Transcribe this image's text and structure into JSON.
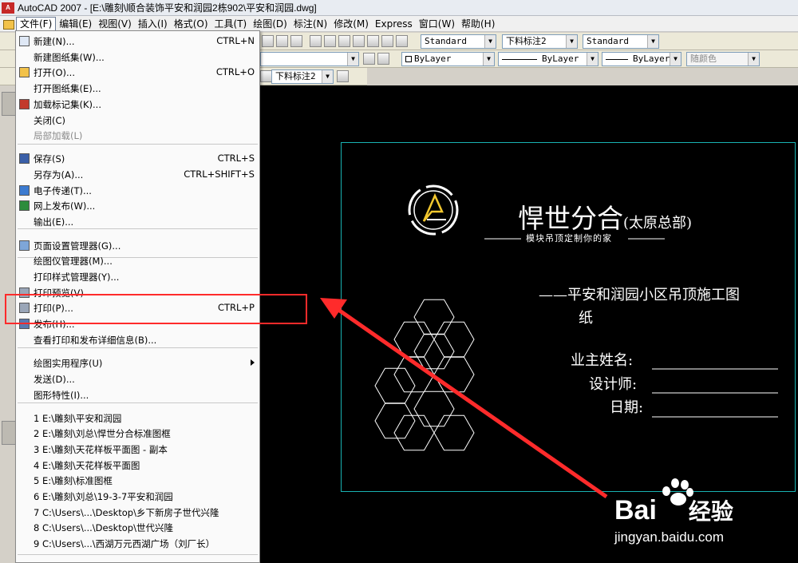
{
  "window": {
    "app_icon_text": "A",
    "title": "AutoCAD 2007 - [E:\\雕刻\\顺合装饰平安和润园2栋902\\平安和润园.dwg]"
  },
  "menubar": {
    "items": [
      {
        "label": "文件(F)",
        "active": true
      },
      {
        "label": "编辑(E)"
      },
      {
        "label": "视图(V)"
      },
      {
        "label": "插入(I)"
      },
      {
        "label": "格式(O)"
      },
      {
        "label": "工具(T)"
      },
      {
        "label": "绘图(D)"
      },
      {
        "label": "标注(N)"
      },
      {
        "label": "修改(M)"
      },
      {
        "label": "Express"
      },
      {
        "label": "窗口(W)"
      },
      {
        "label": "帮助(H)"
      }
    ]
  },
  "toolbars": {
    "text_style": "Standard",
    "dim_style": "下料标注2",
    "table_style": "Standard",
    "color": "ByLayer",
    "linetype": "ByLayer",
    "lineweight": "ByLayer",
    "plot_style": "随颜色",
    "dim_style_2": "下料标注2"
  },
  "file_menu": {
    "items": [
      {
        "label": "新建(N)...",
        "shortcut": "CTRL+N",
        "icon": "new-file-icon"
      },
      {
        "label": "新建图纸集(W)..."
      },
      {
        "label": "打开(O)...",
        "shortcut": "CTRL+O",
        "icon": "open-folder-icon"
      },
      {
        "label": "打开图纸集(E)..."
      },
      {
        "label": "加载标记集(K)...",
        "icon": "markup-icon"
      },
      {
        "label": "关闭(C)"
      },
      {
        "label": "局部加载(L)",
        "disabled": true
      },
      {
        "label": "保存(S)",
        "shortcut": "CTRL+S",
        "icon": "save-icon"
      },
      {
        "label": "另存为(A)...",
        "shortcut": "CTRL+SHIFT+S"
      },
      {
        "label": "电子传递(T)...",
        "icon": "etransmit-icon"
      },
      {
        "label": "网上发布(W)...",
        "icon": "publish-web-icon"
      },
      {
        "label": "输出(E)..."
      },
      {
        "label": "页面设置管理器(G)...",
        "icon": "page-setup-icon"
      },
      {
        "label": "绘图仪管理器(M)..."
      },
      {
        "label": "打印样式管理器(Y)..."
      },
      {
        "label": "打印预览(V)",
        "icon": "plot-preview-icon"
      },
      {
        "label": "打印(P)...",
        "shortcut": "CTRL+P",
        "icon": "print-icon"
      },
      {
        "label": "发布(H)...",
        "icon": "publish-icon"
      },
      {
        "label": "查看打印和发布详细信息(B)..."
      },
      {
        "label": "绘图实用程序(U)",
        "submenu": true
      },
      {
        "label": "发送(D)..."
      },
      {
        "label": "图形特性(I)..."
      },
      {
        "label": "1 E:\\雕刻\\平安和润园"
      },
      {
        "label": "2 E:\\雕刻\\刘总\\悍世分合标准图框"
      },
      {
        "label": "3 E:\\雕刻\\天花样板平面图 - 副本"
      },
      {
        "label": "4 E:\\雕刻\\天花样板平面图"
      },
      {
        "label": "5 E:\\雕刻\\标准图框"
      },
      {
        "label": "6 E:\\雕刻\\刘总\\19-3-7平安和润园"
      },
      {
        "label": "7 C:\\Users\\...\\Desktop\\乡下新房子世代兴隆"
      },
      {
        "label": "8 C:\\Users\\...\\Desktop\\世代兴隆"
      },
      {
        "label": "9 C:\\Users\\...\\西湖万元西湖广场（刘厂长）"
      }
    ]
  },
  "drawing": {
    "company": "悍世分合",
    "company_sub": "(太原总部)",
    "slogan": "模块吊顶定制你的家",
    "project_line1": "——平安和润园小区吊顶施工图",
    "project_line2": "纸",
    "owner_label": "业主姓名:",
    "designer_label": "设计师:",
    "date_label": "日期:",
    "colors": {
      "frame": "#19b2b2",
      "text": "#ffffff",
      "logo_accent": "#f2c72e",
      "highlight": "#ff2b2b"
    }
  },
  "watermark": {
    "brand": "Bai",
    "brand_suffix": "经验",
    "url": "jingyan.baidu.com"
  }
}
